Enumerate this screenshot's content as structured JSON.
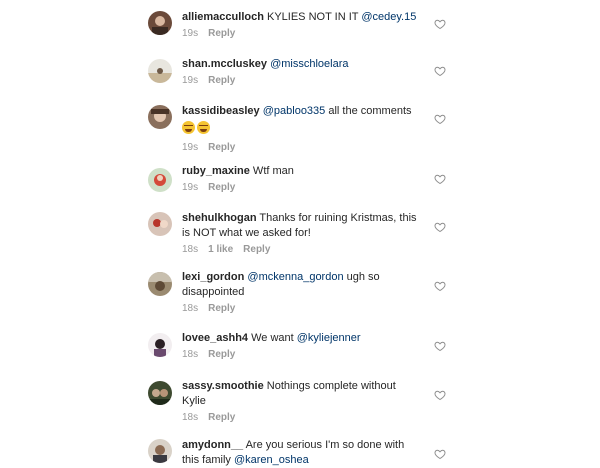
{
  "comments": [
    {
      "username": "alliemacculloch",
      "text_before": " KYLIES NOT IN IT ",
      "mention": "@cedey.15",
      "text_after": "",
      "time": "19s",
      "likes": "",
      "reply": "Reply"
    },
    {
      "username": "shan.mccluskey",
      "text_before": " ",
      "mention": "@misschloelara",
      "text_after": "",
      "time": "19s",
      "likes": "",
      "reply": "Reply"
    },
    {
      "username": "kassidibeasley",
      "text_before": " ",
      "mention": "@pabloo335",
      "text_after": "  all the comments",
      "emoji": "face-with-tears-of-joy x2",
      "time": "19s",
      "likes": "",
      "reply": "Reply"
    },
    {
      "username": "ruby_maxine",
      "text_before": " Wtf man",
      "mention": "",
      "text_after": "",
      "time": "19s",
      "likes": "",
      "reply": "Reply"
    },
    {
      "username": "shehulkhogan",
      "text_before": " Thanks for ruining Kristmas, this is NOT what we asked for!",
      "mention": "",
      "text_after": "",
      "time": "18s",
      "likes": "1 like",
      "reply": "Reply"
    },
    {
      "username": "lexi_gordon",
      "text_before": " ",
      "mention": "@mckenna_gordon",
      "text_after": " ugh so disappointed",
      "time": "18s",
      "likes": "",
      "reply": "Reply"
    },
    {
      "username": "lovee_ashh4",
      "text_before": " We want ",
      "mention": "@kyliejenner",
      "text_after": "",
      "time": "18s",
      "likes": "",
      "reply": "Reply"
    },
    {
      "username": "sassy.smoothie",
      "text_before": " Nothings complete without Kylie",
      "mention": "",
      "text_after": "",
      "time": "18s",
      "likes": "",
      "reply": "Reply"
    },
    {
      "username": "amydonn__",
      "text_before": " Are you serious I'm so done with this family ",
      "mention": "@karen_oshea",
      "text_after": "",
      "time": "",
      "likes": "",
      "reply": ""
    }
  ],
  "icons": {
    "like": "heart-outline-icon",
    "emoji": "face-with-tears-of-joy"
  },
  "colors": {
    "text": "#262626",
    "mention": "#003569",
    "meta": "#999999"
  }
}
